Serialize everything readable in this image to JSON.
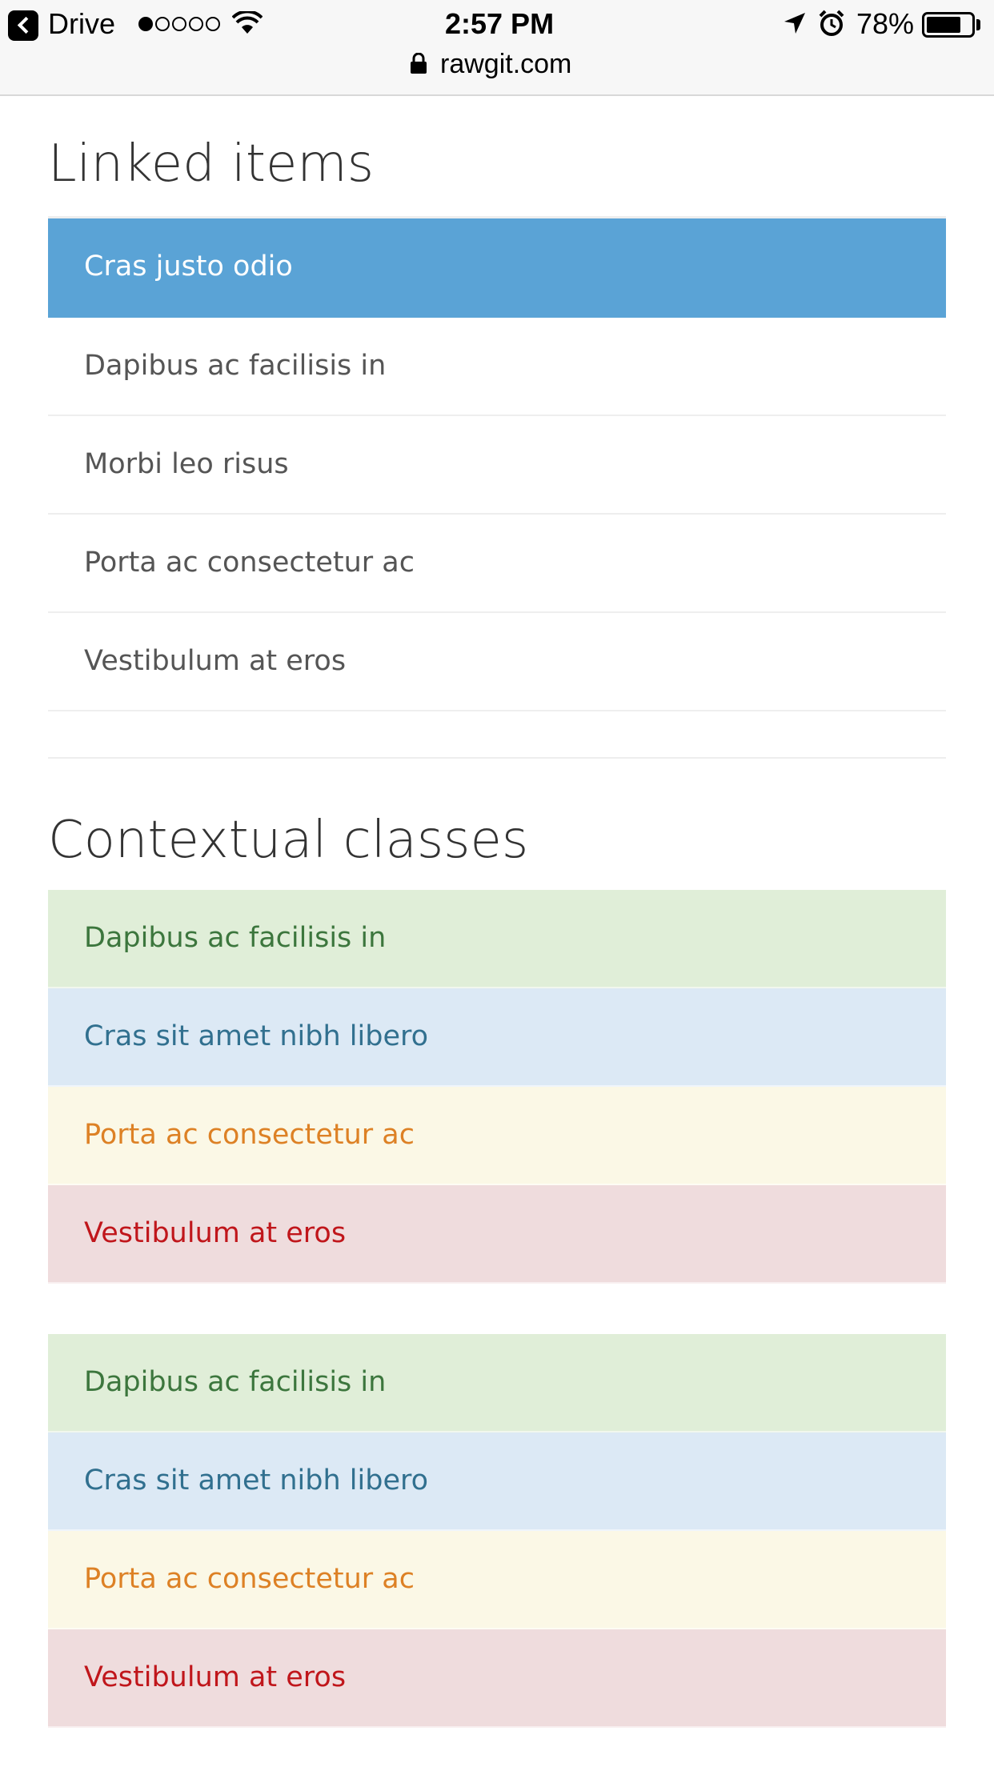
{
  "status_bar": {
    "back_app": "Drive",
    "time": "2:57 PM",
    "battery": "78%",
    "battery_level": 0.78,
    "url": "rawgit.com"
  },
  "linked_items": {
    "title": "Linked items",
    "items": [
      "Cras justo odio",
      "Dapibus ac facilisis in",
      "Morbi leo risus",
      "Porta ac consectetur ac",
      "Vestibulum at eros"
    ],
    "active_color": "#5aa3d6"
  },
  "contextual_classes": {
    "title": "Contextual classes",
    "group1": [
      "Dapibus ac facilisis in",
      "Cras sit amet nibh libero",
      "Porta ac consectetur ac",
      "Vestibulum at eros"
    ],
    "group2": [
      "Dapibus ac facilisis in",
      "Cras sit amet nibh libero",
      "Porta ac consectetur ac",
      "Vestibulum at eros"
    ],
    "colors": {
      "success": "#e0eed8",
      "info": "#dce9f5",
      "warning": "#fbf8e6",
      "danger": "#efdcdd"
    }
  }
}
